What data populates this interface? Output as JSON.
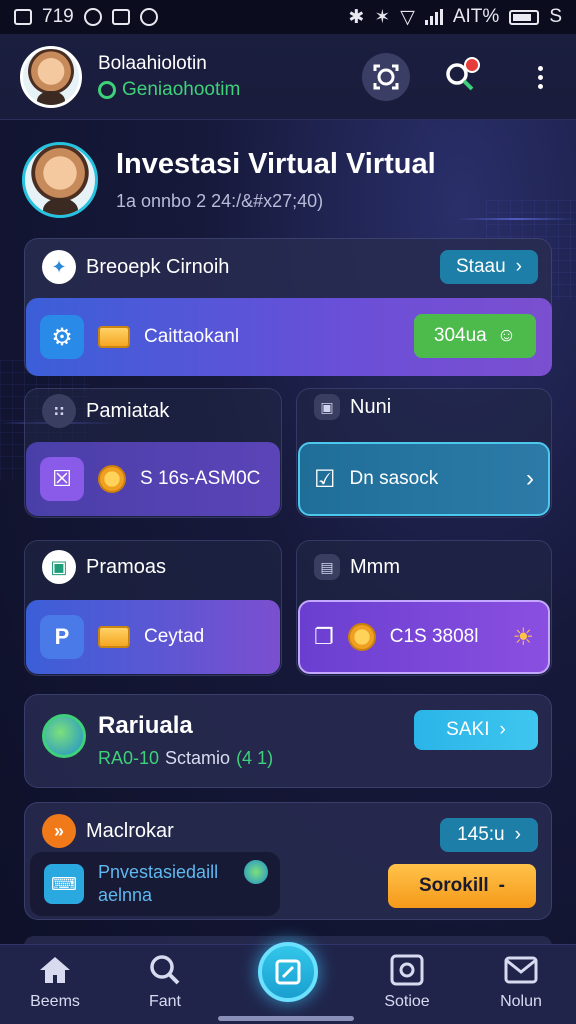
{
  "status_bar": {
    "time": "719",
    "battery_text": "AIT%",
    "extra": "S"
  },
  "header": {
    "name": "Bolaahiolotin",
    "subtitle": "Geniaohootim"
  },
  "hero": {
    "title": "Investasi Virtual Virtual",
    "subtitle": "1a onnbo 2 24:/&#x27;40)"
  },
  "section1": {
    "label": "Breoepk Cirnoih",
    "pill": "Staau",
    "inner_label": "Caittaokanl",
    "inner_button": "304ua"
  },
  "section2": {
    "left_label": "Pamiatak",
    "right_label": "Nuni",
    "left_value": "S 16s-ASM0C",
    "right_value": "Dn sasock"
  },
  "section3": {
    "left_label": "Pramoas",
    "right_label": "Mmm",
    "left_value": "Ceytad",
    "right_value": "C1S 3808l"
  },
  "section4": {
    "title": "Rariuala",
    "subtitle_code": "RA0-10",
    "subtitle_text": "Sctamio",
    "subtitle_count": "(4 1)",
    "pill": "SAKI"
  },
  "section5": {
    "label": "Maclrokar",
    "pill": "145:u",
    "inner_line1": "Pnvestasiedaill",
    "inner_line2": "aelnna",
    "button": "Sorokill"
  },
  "bottom_nav": [
    {
      "label": "Beems",
      "icon": "home-icon"
    },
    {
      "label": "Fant",
      "icon": "search-icon"
    },
    {
      "label": "Sotioe",
      "icon": "camera-icon"
    },
    {
      "label": "Nolun",
      "icon": "mail-icon"
    }
  ],
  "colors": {
    "accent_green": "#3ed17a",
    "accent_cyan": "#25c3df",
    "accent_purple": "#7c4fe0",
    "button_orange": "#f5a623"
  }
}
